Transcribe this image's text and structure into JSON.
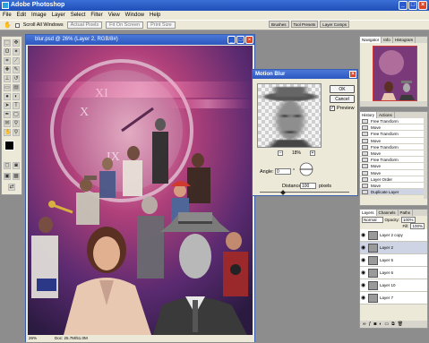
{
  "app": {
    "title": "Adobe Photoshop"
  },
  "menu": [
    "File",
    "Edit",
    "Image",
    "Layer",
    "Select",
    "Filter",
    "View",
    "Window",
    "Help"
  ],
  "options_bar": {
    "checkbox_label": "Scroll All Windows",
    "btn1": "Actual Pixels",
    "btn2": "Fit On Screen",
    "btn3": "Print Size"
  },
  "palette_well": {
    "tabs": [
      "Brushes",
      "Tool Presets",
      "Layer Comps"
    ]
  },
  "document": {
    "title": "blur.psd @ 26% (Layer 2, RGB/8#)",
    "zoom": "26%",
    "doc_size": "Doc: 25.7M/51.0M"
  },
  "motion_blur": {
    "title": "Motion Blur",
    "ok": "OK",
    "cancel": "Cancel",
    "preview_label": "Preview",
    "zoom": "18%",
    "angle_label": "Angle:",
    "angle_value": "0",
    "angle_unit": "°",
    "distance_label": "Distance:",
    "distance_value": "100",
    "distance_unit": "pixels"
  },
  "navigator": {
    "tabs": [
      "Navigator",
      "Info",
      "Histogram"
    ]
  },
  "history": {
    "tabs": [
      "History",
      "Actions"
    ],
    "items": [
      "Free Transform",
      "Move",
      "Free Transform",
      "Move",
      "Free Transform",
      "Move",
      "Free Transform",
      "Move",
      "Move",
      "Layer Order",
      "Move",
      "Duplicate Layer"
    ]
  },
  "layers": {
    "tabs": [
      "Layers",
      "Channels",
      "Paths"
    ],
    "blend_mode": "Normal",
    "opacity_label": "Opacity:",
    "opacity_value": "100%",
    "fill_label": "Fill:",
    "fill_value": "100%",
    "rows": [
      "Layer 2 copy",
      "Layer 2",
      "Layer 5",
      "Layer 6",
      "Layer 10",
      "Layer 7"
    ]
  },
  "colors": {
    "title_blue": "#2c58c0",
    "chrome": "#ece9d8",
    "close_red": "#d9452b"
  }
}
